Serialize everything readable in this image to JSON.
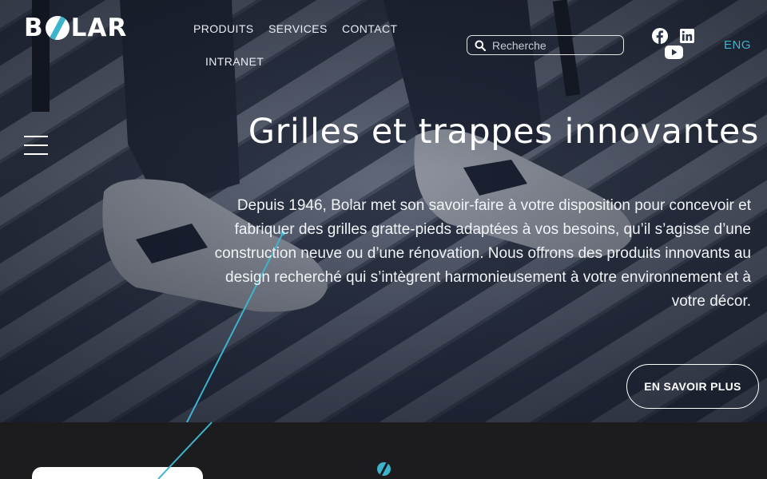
{
  "header": {
    "logo_text": "BOLAR",
    "nav": [
      {
        "label": "PRODUITS"
      },
      {
        "label": "SERVICES"
      },
      {
        "label": "CONTACT"
      },
      {
        "label": "INTRANET"
      }
    ],
    "search": {
      "placeholder": "Recherche",
      "value": ""
    },
    "social": [
      {
        "icon": "facebook-icon"
      },
      {
        "icon": "linkedin-icon"
      },
      {
        "icon": "youtube-icon"
      }
    ],
    "language_label": "ENG"
  },
  "hero": {
    "title": "Grilles et trappes innovantes",
    "description": "Depuis 1946, Bolar met son savoir-faire à votre disposition pour concevoir et fabriquer des grilles gratte-pieds adaptées à vos besoins, qu’il s’agisse d’une construction neuve ou d’une rénovation. Nous offrons des produits innovants au design recherché qui s’intègrent harmonieusement à votre environnement et à votre décor.",
    "cta_label": "EN SAVOIR PLUS"
  },
  "colors": {
    "accent": "#3db4cc",
    "dark_section": "#1c1c1e",
    "text": "#ffffff"
  }
}
